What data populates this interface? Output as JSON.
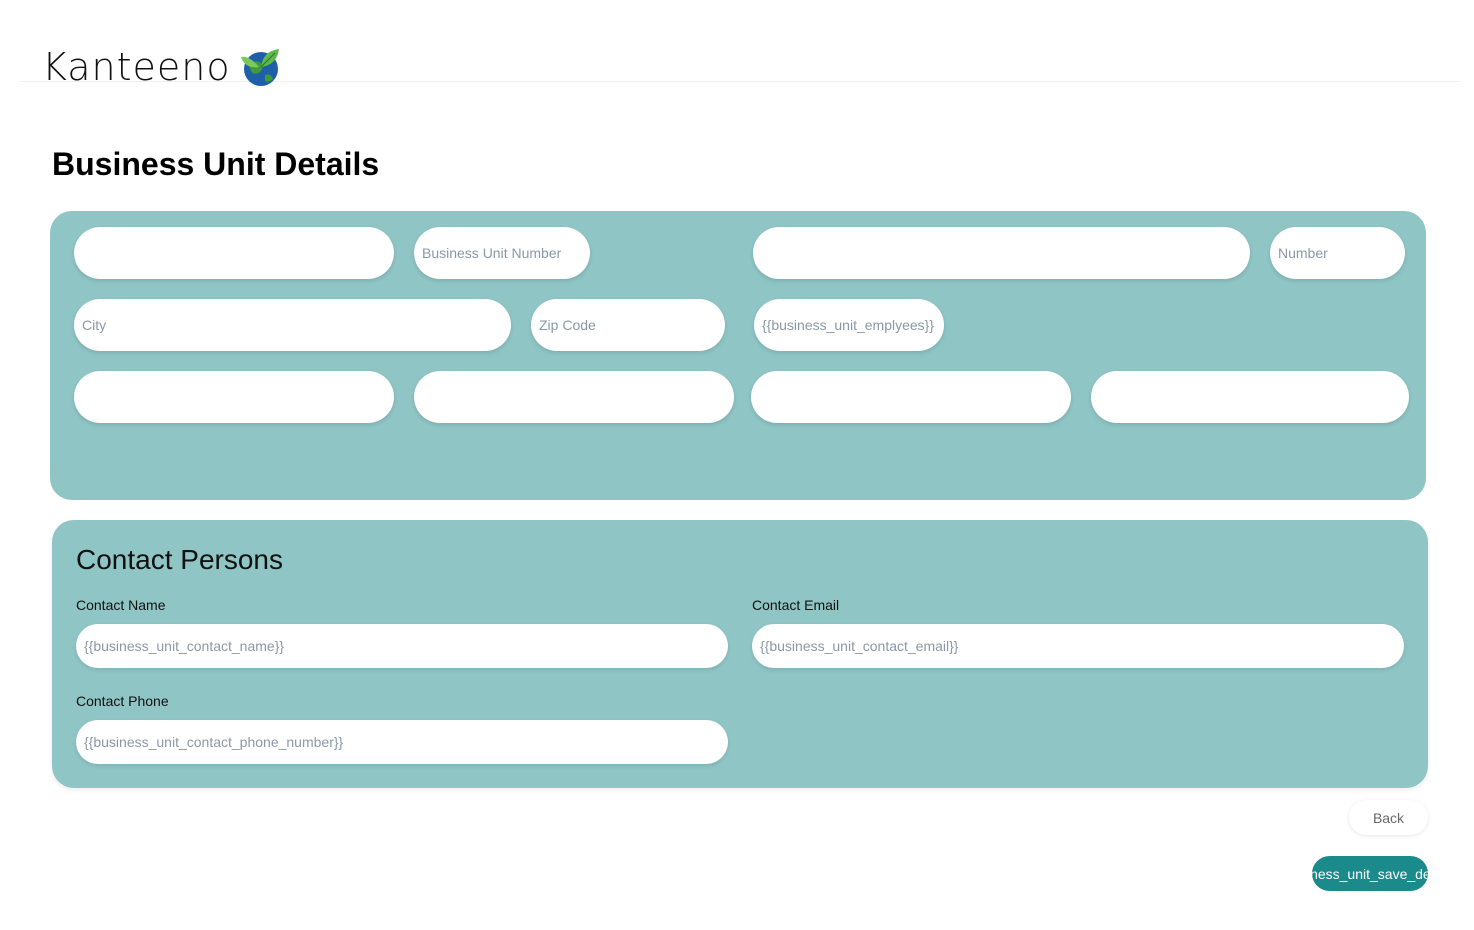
{
  "header": {
    "logo_text": "Kanteeno"
  },
  "page": {
    "title": "Business Unit Details"
  },
  "details": {
    "row1": {
      "field1_placeholder": "",
      "business_unit_number_placeholder": "Business Unit Number",
      "field3_placeholder": "",
      "number_placeholder": "Number"
    },
    "row2": {
      "city_placeholder": "City",
      "zip_code_placeholder": "Zip Code",
      "employees_placeholder": "{{business_unit_emplyees}}"
    },
    "row3": {
      "field1_placeholder": "",
      "field2_placeholder": "",
      "field3_placeholder": "",
      "field4_placeholder": ""
    }
  },
  "contact": {
    "title": "Contact Persons",
    "name_label": "Contact Name",
    "name_placeholder": "{{business_unit_contact_name}}",
    "email_label": "Contact Email",
    "email_placeholder": "{{business_unit_contact_email}}",
    "phone_label": "Contact Phone",
    "phone_placeholder": "{{business_unit_contact_phone_number}}"
  },
  "actions": {
    "back_label": "Back",
    "save_label": "{{business_unit_save_details}}"
  },
  "colors": {
    "panel": "#8fc5c5",
    "primary_button": "#1a8a8a"
  }
}
